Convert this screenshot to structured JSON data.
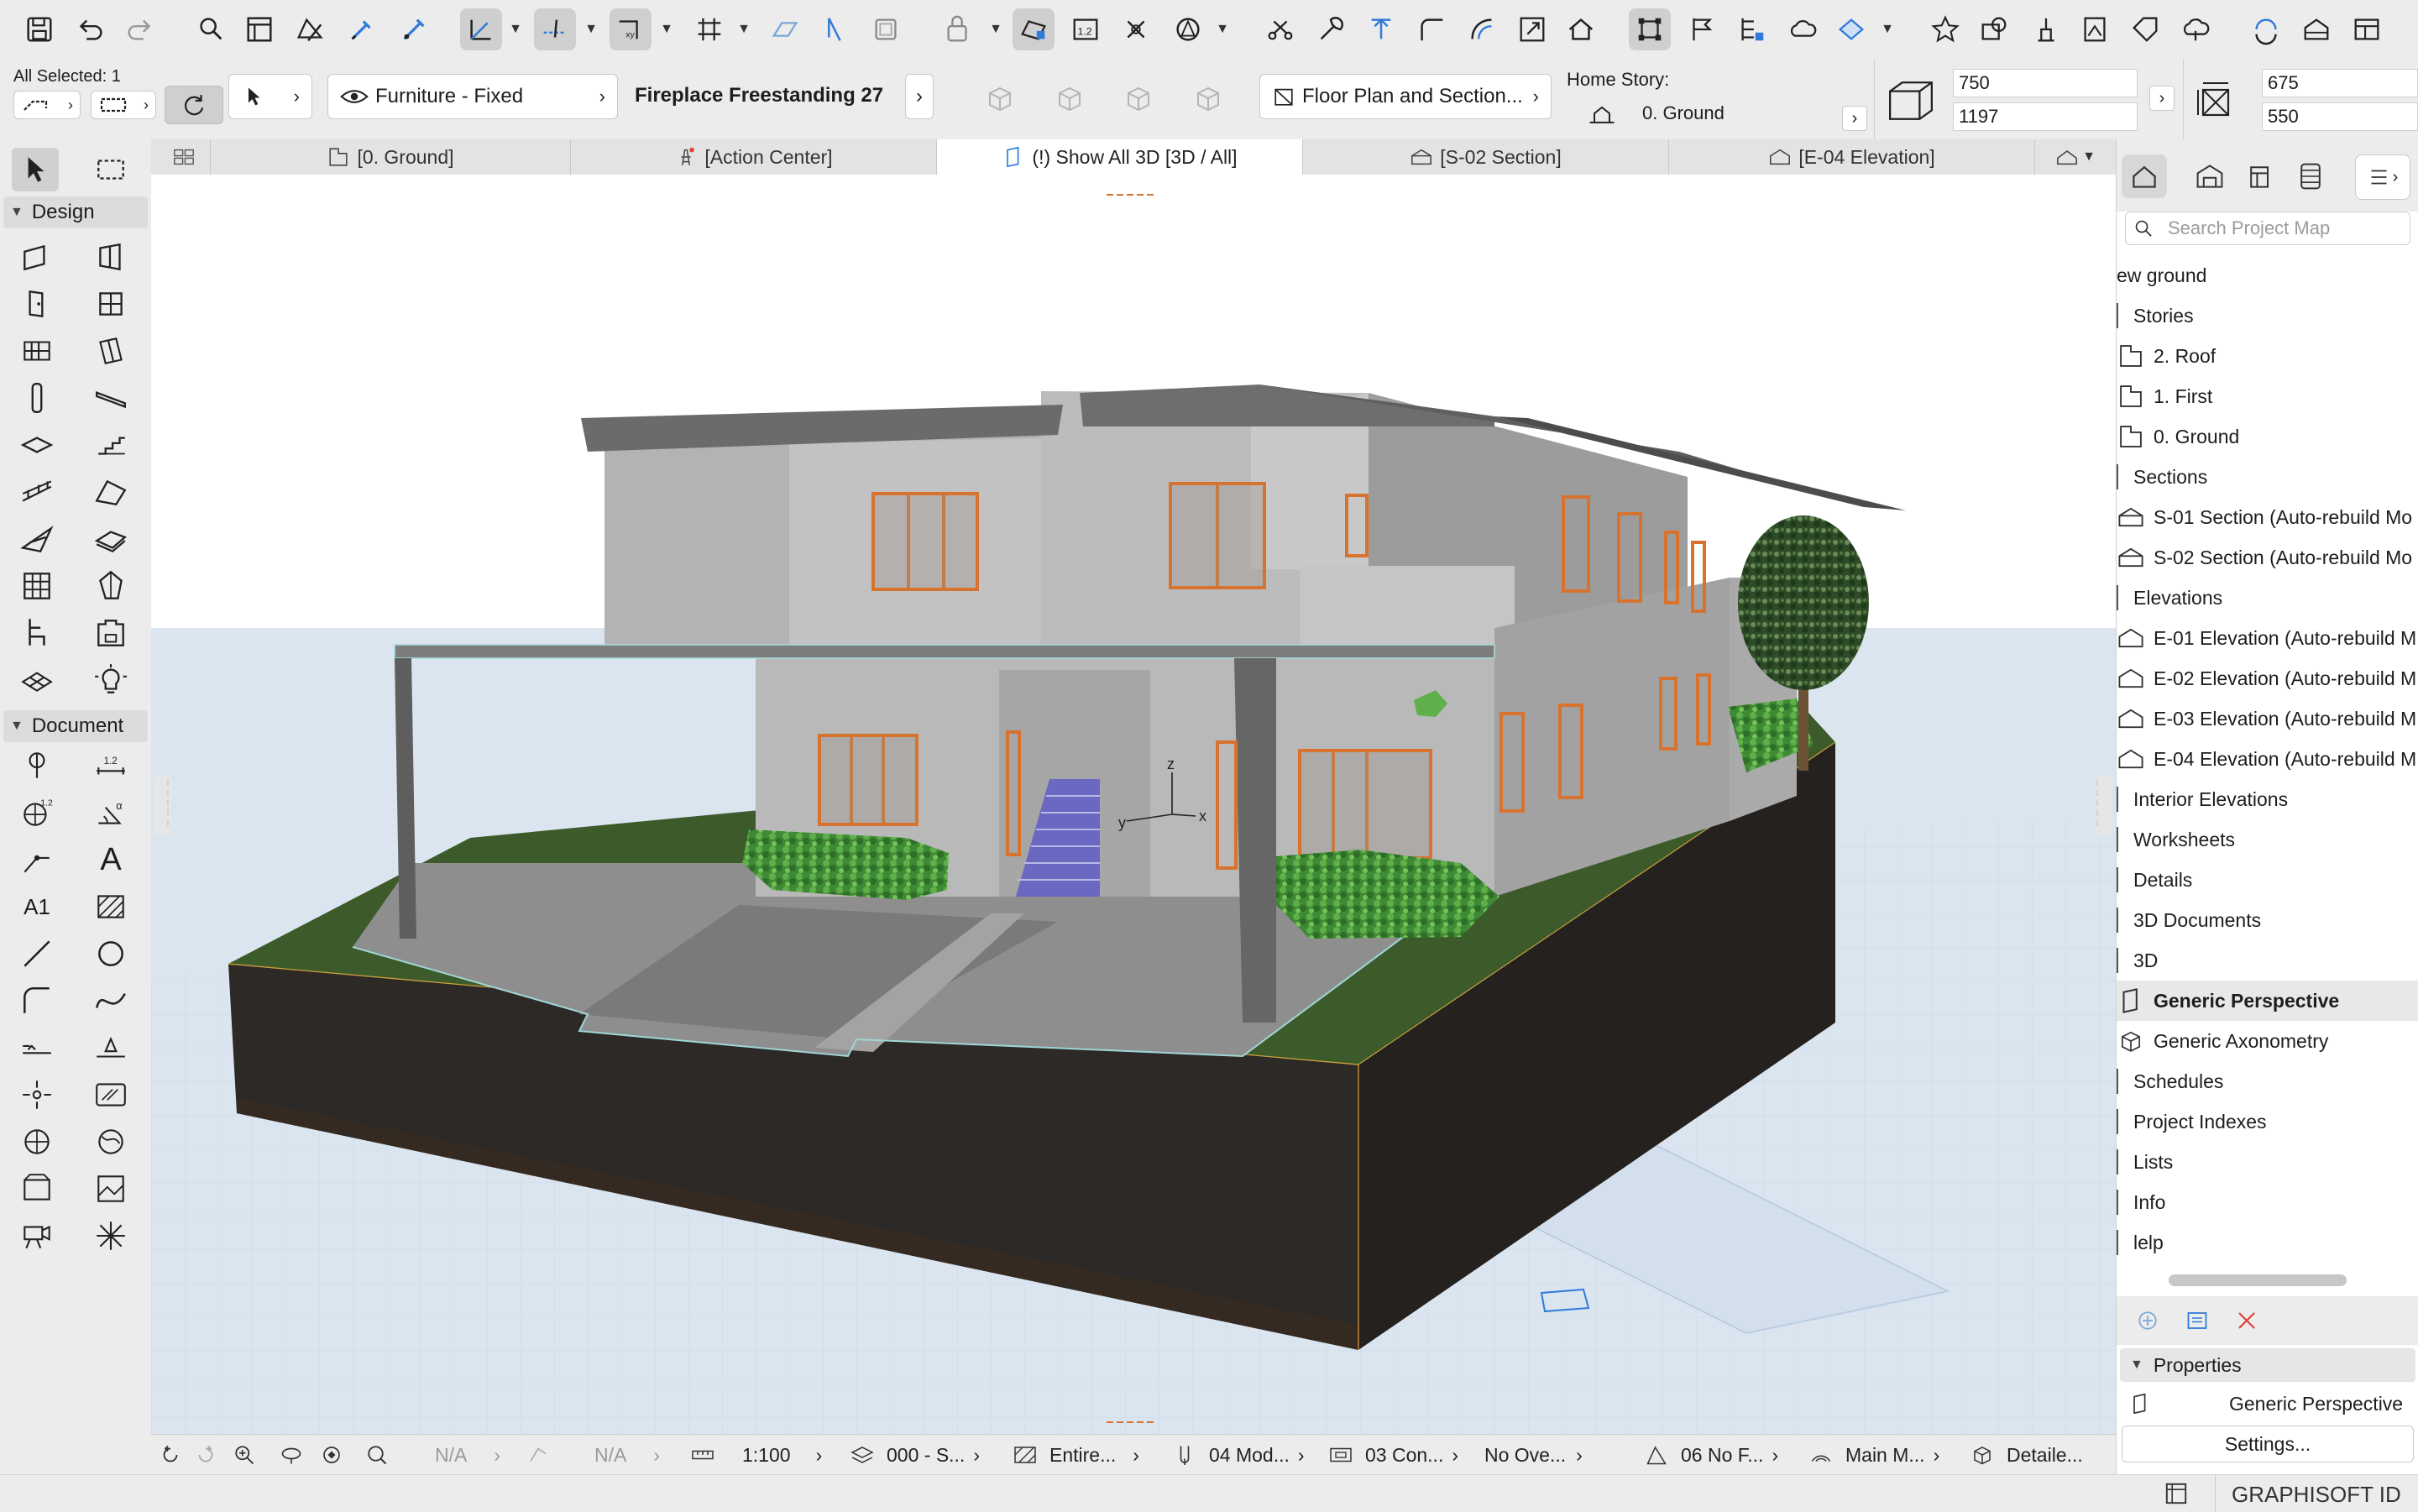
{
  "toolbar": {
    "icons": [
      "save-icon",
      "undo-icon",
      "redo-icon",
      "find-select-icon",
      "teamwork-icon",
      "magic-wand-icon",
      "eyedropper-icon",
      "syringe-icon",
      "guide-icon",
      "snap-guide-icon",
      "xy-coordinate-icon",
      "grid-snap-icon",
      "plane-icon",
      "trace-icon",
      "layer-icon",
      "suspend-group-icon",
      "renovation-icon",
      "calc-icon",
      "measure-icon",
      "cross-icon",
      "shape-icon",
      "split-icon",
      "adjust-icon",
      "elevate-icon",
      "fillet-icon",
      "offset-icon",
      "resize-icon",
      "roof-icon",
      "transform-icon",
      "flag-icon",
      "drawing-icon",
      "cloud-icon",
      "shape-edit-icon",
      "favorites-icon",
      "view-map-icon",
      "render-icon",
      "publish-icon",
      "tag-icon",
      "bim-cloud-icon",
      "teamwork-send-icon",
      "floor-plan-icon",
      "layout-icon"
    ]
  },
  "infobox": {
    "selection_label": "All Selected: 1",
    "layer_value": "Furniture - Fixed",
    "element_name": "Fireplace Freestanding 27",
    "view_button": "Floor Plan and Section...",
    "home_story_label": "Home Story:",
    "home_story_value": "0. Ground",
    "size_a_1": "750",
    "size_a_2": "1197",
    "size_b_1": "675",
    "size_b_2": "550"
  },
  "toolbox": {
    "design_label": "Design",
    "document_label": "Document",
    "dim_label_a": "1.2",
    "dim_label_b": "1.2",
    "text_tool": "A",
    "label_tool": "A1"
  },
  "tabs": [
    {
      "label": "[0. Ground]",
      "icon": "floor-plan-icon"
    },
    {
      "label": "[Action Center]",
      "icon": "action-center-icon"
    },
    {
      "label": "(!) Show All 3D [3D / All]",
      "icon": "3d-view-icon"
    },
    {
      "label": "[S-02 Section]",
      "icon": "section-icon"
    },
    {
      "label": "[E-04 Elevation]",
      "icon": "elevation-icon"
    }
  ],
  "viewport": {
    "axis_x": "x",
    "axis_y": "y",
    "axis_z": "z"
  },
  "bottombar": {
    "na_1": "N/A",
    "na_2": "N/A",
    "scale": "1:100",
    "layer_combo": "000 - S...",
    "structure": "Entire...",
    "pen_set": "04 Mod...",
    "model_view": "03 Con...",
    "override": "No Ove...",
    "renovation": "06 No F...",
    "dimension": "Main M...",
    "detail": "Detaile..."
  },
  "navigator": {
    "search_placeholder": "Search Project Map",
    "items": [
      {
        "label": "ew ground",
        "type": "root"
      },
      {
        "label": "Stories",
        "type": "folder"
      },
      {
        "label": "2. Roof",
        "type": "story"
      },
      {
        "label": "1. First",
        "type": "story"
      },
      {
        "label": "0. Ground",
        "type": "story"
      },
      {
        "label": "Sections",
        "type": "folder"
      },
      {
        "label": "S-01 Section (Auto-rebuild Mo",
        "type": "section"
      },
      {
        "label": "S-02 Section (Auto-rebuild Mo",
        "type": "section"
      },
      {
        "label": "Elevations",
        "type": "folder"
      },
      {
        "label": "E-01 Elevation (Auto-rebuild M",
        "type": "elevation"
      },
      {
        "label": "E-02 Elevation (Auto-rebuild M",
        "type": "elevation"
      },
      {
        "label": "E-03 Elevation (Auto-rebuild M",
        "type": "elevation"
      },
      {
        "label": "E-04 Elevation (Auto-rebuild M",
        "type": "elevation"
      },
      {
        "label": "Interior Elevations",
        "type": "folder"
      },
      {
        "label": "Worksheets",
        "type": "folder"
      },
      {
        "label": "Details",
        "type": "folder"
      },
      {
        "label": "3D Documents",
        "type": "folder"
      },
      {
        "label": "3D",
        "type": "folder"
      },
      {
        "label": "Generic Perspective",
        "type": "perspective",
        "selected": true
      },
      {
        "label": "Generic Axonometry",
        "type": "axonometry"
      },
      {
        "label": "Schedules",
        "type": "folder"
      },
      {
        "label": "Project Indexes",
        "type": "folder"
      },
      {
        "label": "Lists",
        "type": "folder"
      },
      {
        "label": "Info",
        "type": "folder"
      },
      {
        "label": "lelp",
        "type": "folder"
      }
    ],
    "properties_label": "Properties",
    "properties_value": "Generic Perspective",
    "settings_button": "Settings..."
  },
  "statusbar": {
    "brand": "GRAPHISOFT ID"
  },
  "colors": {
    "accent": "#2f7bd9",
    "window_orange": "#d8732f",
    "wall_gray": "#bdbdbd",
    "grass": "#3b5a2a",
    "soil": "#2f2c28",
    "ground_plane": "#dbe5ef",
    "delete_red": "#e0433a"
  }
}
